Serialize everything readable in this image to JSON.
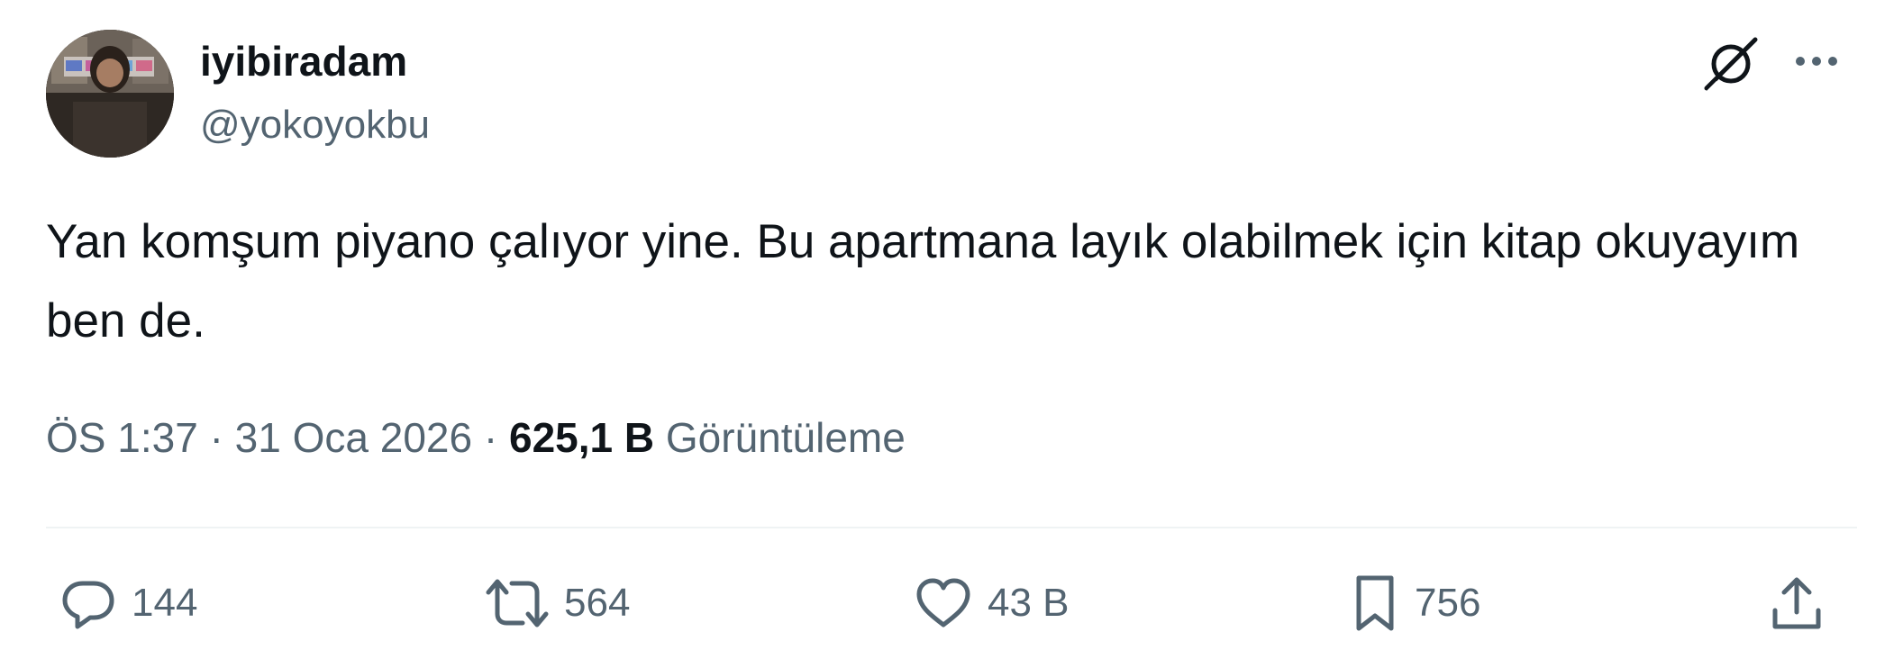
{
  "author": {
    "display_name": "iyibiradam",
    "handle": "@yokoyokbu",
    "avatar_icon": "profile-photo"
  },
  "header_actions": {
    "grok_icon": "grok-icon",
    "more_icon": "more-horizontal-icon"
  },
  "tweet": {
    "text": "Yan komşum piyano çalıyor yine. Bu apartmana layık olabilmek için kitap okuyayım ben de."
  },
  "meta": {
    "time": "ÖS 1:37",
    "separator": "·",
    "date": "31 Oca 2026",
    "views_count": "625,1 B",
    "views_label": "Görüntüleme"
  },
  "actions": {
    "reply": {
      "icon": "reply-icon",
      "count": "144"
    },
    "retweet": {
      "icon": "retweet-icon",
      "count": "564"
    },
    "like": {
      "icon": "heart-icon",
      "count": "43 B"
    },
    "bookmark": {
      "icon": "bookmark-icon",
      "count": "756"
    },
    "share": {
      "icon": "share-icon"
    }
  },
  "colors": {
    "text_primary": "#0f1419",
    "text_secondary": "#536471",
    "divider": "#eff3f4",
    "background": "#ffffff"
  }
}
